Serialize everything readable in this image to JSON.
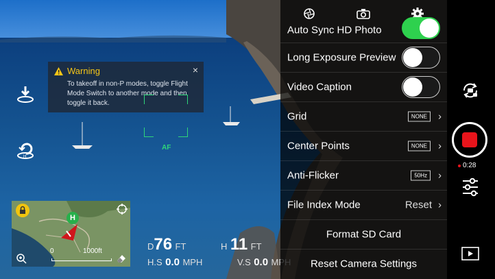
{
  "warning": {
    "title": "Warning",
    "message": "To takeoff in non-P modes, toggle Flight Mode Switch to another mode and then toggle it back.",
    "close_glyph": "×"
  },
  "camera_view": {
    "focus_label": "AF"
  },
  "left_controls": [
    {
      "name": "takeoff-icon"
    },
    {
      "name": "return-home-icon"
    }
  ],
  "map": {
    "home_marker": "H",
    "scale_start": "0",
    "scale_end": "1000ft"
  },
  "telemetry": {
    "distance": {
      "prefix": "D",
      "value": "76",
      "unit": "FT"
    },
    "height": {
      "prefix": "H",
      "value": "11",
      "unit": "FT"
    },
    "h_speed": {
      "prefix": "H.S",
      "value": "0.0",
      "unit": "MPH"
    },
    "v_speed": {
      "prefix": "V.S",
      "value": "0.0",
      "unit": "MPH"
    }
  },
  "settings_panel": {
    "tabs": [
      {
        "icon": "aperture-icon"
      },
      {
        "icon": "camera-icon"
      },
      {
        "icon": "gear-icon"
      }
    ],
    "rows": [
      {
        "label": "Auto Sync HD Photo",
        "type": "toggle",
        "on": true
      },
      {
        "label": "Long Exposure Preview",
        "type": "toggle",
        "on": false
      },
      {
        "label": "Video Caption",
        "type": "toggle",
        "on": false
      },
      {
        "label": "Grid",
        "type": "badge",
        "badge": "NONE"
      },
      {
        "label": "Center Points",
        "type": "badge",
        "badge": "NONE"
      },
      {
        "label": "Anti-Flicker",
        "type": "badge",
        "badge": "50Hz"
      },
      {
        "label": "File Index Mode",
        "type": "value",
        "value": "Reset"
      },
      {
        "label": "Format SD Card",
        "type": "action"
      },
      {
        "label": "Reset Camera Settings",
        "type": "action"
      }
    ],
    "chevron": "›"
  },
  "right_controls": {
    "record_time": "0:28",
    "record_color": "#e8141b",
    "accent_green": "#2ed14e"
  }
}
